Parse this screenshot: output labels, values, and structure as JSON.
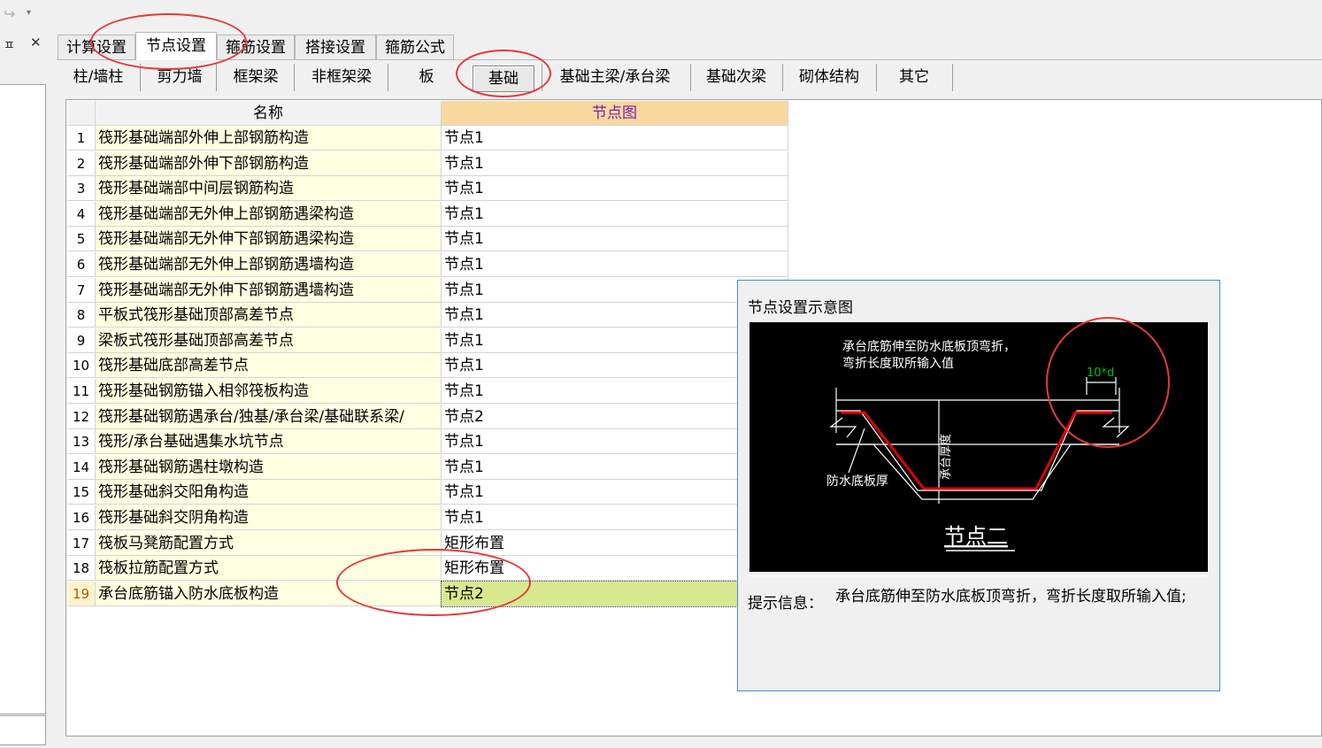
{
  "toolbar": {
    "undo_icon": "↪",
    "dropdown_icon": "▾"
  },
  "left_panel": {
    "pin_icon": "ᵖ",
    "pin_text": "ㅍ",
    "close_icon": "✕"
  },
  "main_tabs": [
    {
      "label": "计算设置",
      "active": false
    },
    {
      "label": "节点设置",
      "active": true
    },
    {
      "label": "箍筋设置",
      "active": false
    },
    {
      "label": "搭接设置",
      "active": false
    },
    {
      "label": "箍筋公式",
      "active": false
    }
  ],
  "sub_tabs": [
    {
      "label": "柱/墙柱"
    },
    {
      "label": "剪力墙"
    },
    {
      "label": "框架梁"
    },
    {
      "label": "非框架梁"
    },
    {
      "label": "板"
    },
    {
      "label": "基础",
      "active": true
    },
    {
      "label": "基础主梁/承台梁"
    },
    {
      "label": "基础次梁"
    },
    {
      "label": "砌体结构"
    },
    {
      "label": "其它"
    }
  ],
  "grid": {
    "headers": {
      "name": "名称",
      "value": "节点图"
    },
    "rows": [
      {
        "num": "1",
        "name": "筏形基础端部外伸上部钢筋构造",
        "value": "节点1"
      },
      {
        "num": "2",
        "name": "筏形基础端部外伸下部钢筋构造",
        "value": "节点1"
      },
      {
        "num": "3",
        "name": "筏形基础端部中间层钢筋构造",
        "value": "节点1"
      },
      {
        "num": "4",
        "name": "筏形基础端部无外伸上部钢筋遇梁构造",
        "value": "节点1"
      },
      {
        "num": "5",
        "name": "筏形基础端部无外伸下部钢筋遇梁构造",
        "value": "节点1"
      },
      {
        "num": "6",
        "name": "筏形基础端部无外伸上部钢筋遇墙构造",
        "value": "节点1"
      },
      {
        "num": "7",
        "name": "筏形基础端部无外伸下部钢筋遇墙构造",
        "value": "节点1"
      },
      {
        "num": "8",
        "name": "平板式筏形基础顶部高差节点",
        "value": "节点1"
      },
      {
        "num": "9",
        "name": "梁板式筏形基础顶部高差节点",
        "value": "节点1"
      },
      {
        "num": "10",
        "name": "筏形基础底部高差节点",
        "value": "节点1"
      },
      {
        "num": "11",
        "name": "筏形基础钢筋锚入相邻筏板构造",
        "value": "节点1"
      },
      {
        "num": "12",
        "name": "筏形基础钢筋遇承台/独基/承台梁/基础联系梁/",
        "value": "节点2"
      },
      {
        "num": "13",
        "name": "筏形/承台基础遇集水坑节点",
        "value": "节点1"
      },
      {
        "num": "14",
        "name": "筏形基础钢筋遇柱墩构造",
        "value": "节点1"
      },
      {
        "num": "15",
        "name": "筏形基础斜交阳角构造",
        "value": "节点1"
      },
      {
        "num": "16",
        "name": "筏形基础斜交阴角构造",
        "value": "节点1"
      },
      {
        "num": "17",
        "name": "筏板马凳筋配置方式",
        "value": "矩形布置"
      },
      {
        "num": "18",
        "name": "筏板拉筋配置方式",
        "value": "矩形布置"
      },
      {
        "num": "19",
        "name": "承台底筋锚入防水底板构造",
        "value": "节点2",
        "selected": true
      }
    ]
  },
  "popup": {
    "title": "节点设置示意图",
    "diagram": {
      "note_line1": "承台底筋伸至防水底板顶弯折，",
      "note_line2": "弯折长度取所输入值",
      "dim_label": "10*d",
      "thickness_label": "承台厚度",
      "slab_label": "防水底板厚",
      "caption": "节点二"
    },
    "hint_label": "提示信息：",
    "hint_text": "承台底筋伸至防水底板顶弯折，弯折长度取所输入值;"
  },
  "colors": {
    "header_highlight": "#f7d9a0",
    "name_cell": "#ffffe1",
    "selected_value": "#d8e88e",
    "annotation": "#e23a3a",
    "rebar": "#e00000",
    "dim_green": "#00c000"
  }
}
